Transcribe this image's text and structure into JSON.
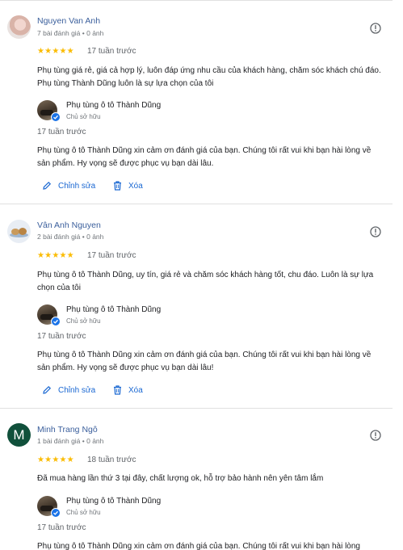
{
  "reviews": [
    {
      "reviewer_name": "Nguyen Van Anh",
      "reviewer_meta": "7 bài đánh giá • 0 ảnh",
      "rating_stars": "★★★★★",
      "rating": 5,
      "time": "17 tuần trước",
      "text": "Phụ tùng giá rẻ, giá cả hợp lý, luôn đáp ứng nhu cầu của khách hàng, chăm sóc khách chú đáo. Phụ tùng Thành Dũng luôn là sự lựa chọn của tôi",
      "reply": {
        "owner_name": "Phụ tùng ô tô Thành Dũng",
        "owner_role": "Chủ sở hữu",
        "time": "17 tuần trước",
        "text": "Phụ tùng ô tô Thành Dũng xin cảm ơn đánh giá của bạn. Chúng tôi rất vui khi bạn hài lòng về sản phẩm. Hy vọng sẽ được phục vụ bạn dài lâu."
      }
    },
    {
      "reviewer_name": "Vân Anh Nguyen",
      "reviewer_meta": "2 bài đánh giá • 0 ảnh",
      "rating_stars": "★★★★★",
      "rating": 5,
      "time": "17 tuần trước",
      "text": "Phụ tùng ô tô Thành Dũng, uy tín, giá rẻ và chăm sóc khách hàng tốt, chu đáo. Luôn là sự lựa chọn của tôi",
      "reply": {
        "owner_name": "Phụ tùng ô tô Thành Dũng",
        "owner_role": "Chủ sở hữu",
        "time": "17 tuần trước",
        "text": "Phụ tùng ô tô Thành Dũng xin cảm ơn đánh giá của bạn. Chúng tôi rất vui khi bạn hài lòng về sản phẩm. Hy vọng sẽ được phục vụ bạn dài lâu!"
      }
    },
    {
      "reviewer_name": "Minh Trang Ngô",
      "reviewer_initial": "M",
      "reviewer_meta": "1 bài đánh giá • 0 ảnh",
      "rating_stars": "★★★★★",
      "rating": 5,
      "time": "18 tuần trước",
      "text": "Đã mua hàng lần thứ 3 tại đây, chất lượng ok, hỗ trợ bảo hành nên yên tâm lắm",
      "reply": {
        "owner_name": "Phụ tùng ô tô Thành Dũng",
        "owner_role": "Chủ sở hữu",
        "time": "17 tuần trước",
        "text": "Phụ tùng ô tô Thành Dũng xin cảm ơn đánh giá của bạn. Chúng tôi rất vui khi bạn hài lòng"
      }
    }
  ],
  "actions": {
    "edit_label": "Chỉnh sửa",
    "delete_label": "Xóa"
  },
  "colors": {
    "star": "#fbbc04",
    "link": "#1967d2",
    "verified": "#1a73e8",
    "avatar_m": "#10503b"
  },
  "icons": {
    "more": "info-circle-icon",
    "edit": "pencil-icon",
    "delete": "trash-icon",
    "verified": "verified-check-icon"
  }
}
